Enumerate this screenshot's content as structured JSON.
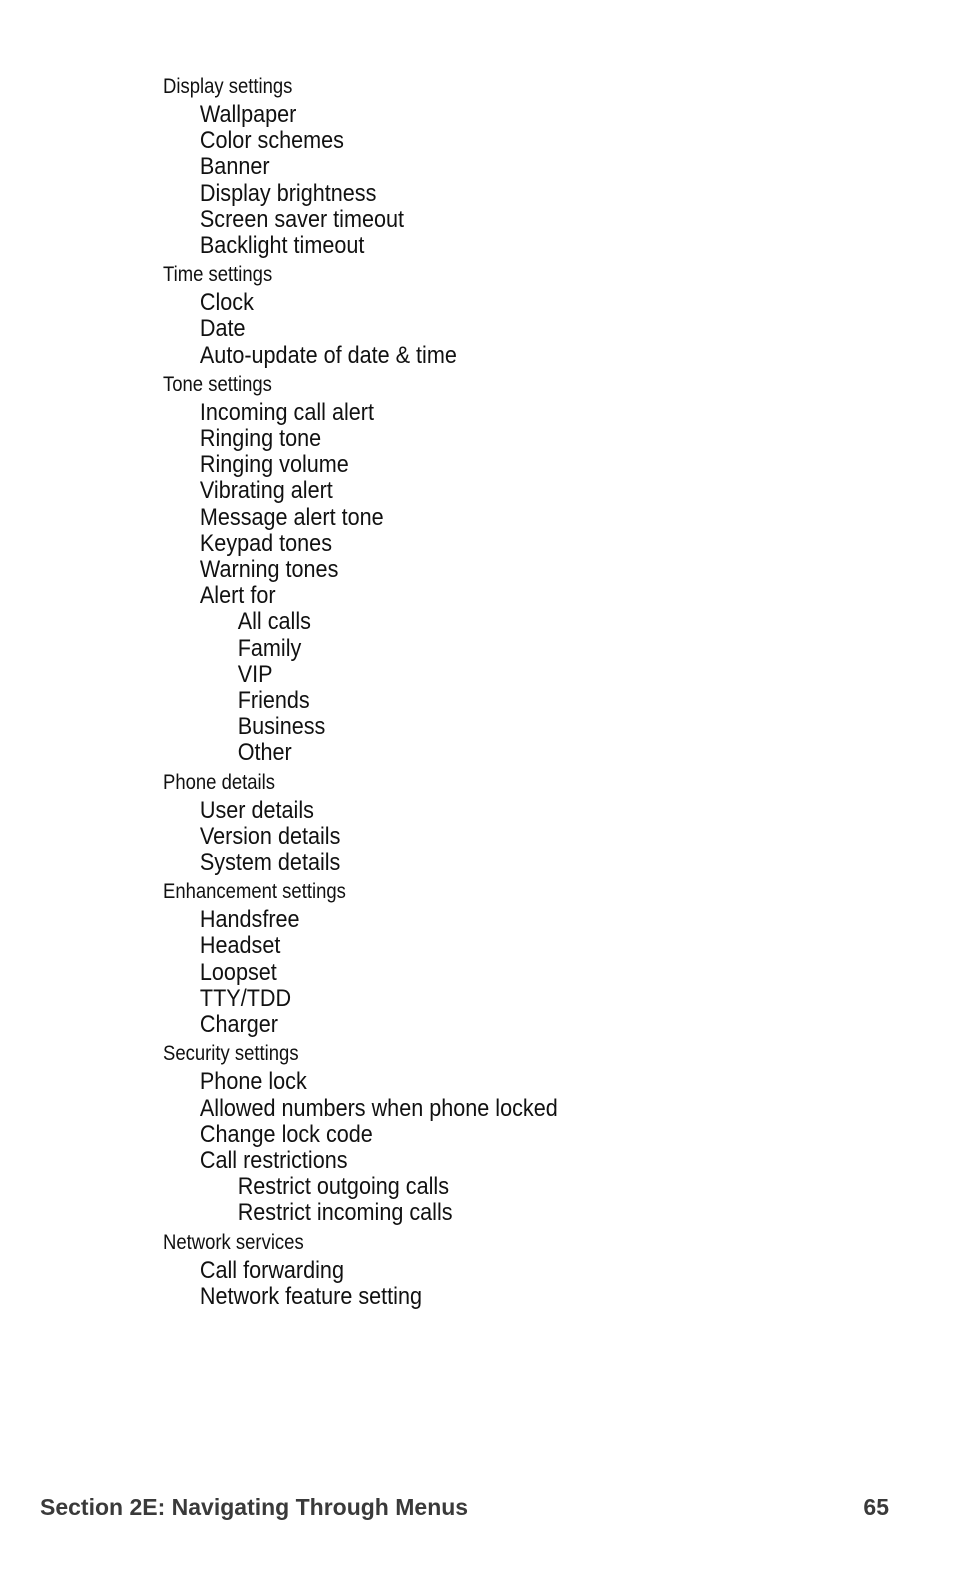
{
  "sections": [
    {
      "title": "Display settings",
      "items": [
        {
          "label": "Wallpaper",
          "level": 1
        },
        {
          "label": "Color schemes",
          "level": 1
        },
        {
          "label": "Banner",
          "level": 1
        },
        {
          "label": "Display brightness",
          "level": 1
        },
        {
          "label": "Screen saver timeout",
          "level": 1
        },
        {
          "label": "Backlight timeout",
          "level": 1
        }
      ]
    },
    {
      "title": "Time settings",
      "items": [
        {
          "label": "Clock",
          "level": 1
        },
        {
          "label": "Date",
          "level": 1
        },
        {
          "label": "Auto-update of date & time",
          "level": 1
        }
      ]
    },
    {
      "title": "Tone settings",
      "items": [
        {
          "label": "Incoming call alert",
          "level": 1
        },
        {
          "label": "Ringing tone",
          "level": 1
        },
        {
          "label": "Ringing volume",
          "level": 1
        },
        {
          "label": "Vibrating alert",
          "level": 1
        },
        {
          "label": "Message alert tone",
          "level": 1
        },
        {
          "label": "Keypad tones",
          "level": 1
        },
        {
          "label": "Warning tones",
          "level": 1
        },
        {
          "label": "Alert for",
          "level": 1
        },
        {
          "label": "All calls",
          "level": 2
        },
        {
          "label": "Family",
          "level": 2
        },
        {
          "label": "VIP",
          "level": 2
        },
        {
          "label": "Friends",
          "level": 2
        },
        {
          "label": "Business",
          "level": 2
        },
        {
          "label": "Other",
          "level": 2
        }
      ]
    },
    {
      "title": "Phone details",
      "items": [
        {
          "label": "User details",
          "level": 1
        },
        {
          "label": "Version details",
          "level": 1
        },
        {
          "label": "System details",
          "level": 1
        }
      ]
    },
    {
      "title": "Enhancement settings",
      "items": [
        {
          "label": "Handsfree",
          "level": 1
        },
        {
          "label": "Headset",
          "level": 1
        },
        {
          "label": "Loopset",
          "level": 1
        },
        {
          "label": "TTY/TDD",
          "level": 1
        },
        {
          "label": "Charger",
          "level": 1
        }
      ]
    },
    {
      "title": "Security settings",
      "items": [
        {
          "label": "Phone lock",
          "level": 1
        },
        {
          "label": "Allowed numbers when phone locked",
          "level": 1
        },
        {
          "label": "Change lock code",
          "level": 1
        },
        {
          "label": "Call restrictions",
          "level": 1
        },
        {
          "label": "Restrict outgoing calls",
          "level": 2
        },
        {
          "label": "Restrict incoming calls",
          "level": 2
        }
      ]
    },
    {
      "title": "Network services",
      "items": [
        {
          "label": "Call forwarding",
          "level": 1
        },
        {
          "label": "Network feature setting",
          "level": 1
        }
      ]
    }
  ],
  "footer": {
    "section_title": "Section 2E: Navigating Through Menus",
    "page_number": "65"
  }
}
